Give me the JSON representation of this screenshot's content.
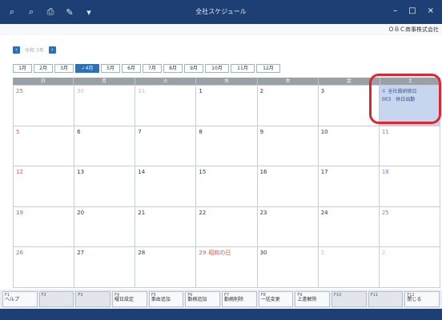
{
  "window": {
    "title": "全社スケジュール",
    "minimize": "–",
    "maximize": "□",
    "close": "×"
  },
  "toolbar": [
    {
      "icon": "search-plus-icon",
      "glyph": "⌕"
    },
    {
      "icon": "search-icon",
      "glyph": "⌕"
    },
    {
      "icon": "printer-icon",
      "glyph": "⎙"
    },
    {
      "icon": "pen-icon",
      "glyph": "✎"
    },
    {
      "icon": "dropdown-icon",
      "glyph": "▾"
    }
  ],
  "company": "ＯＢＣ商事株式会社",
  "year_selector": {
    "prev": "‹",
    "label": "令和 3年",
    "next": "›"
  },
  "months": [
    {
      "label": "1月"
    },
    {
      "label": "2月"
    },
    {
      "label": "3月"
    },
    {
      "label": "✓4月",
      "active": true
    },
    {
      "label": "5月"
    },
    {
      "label": "6月"
    },
    {
      "label": "7月"
    },
    {
      "label": "8月"
    },
    {
      "label": "9月"
    },
    {
      "label": "10月"
    },
    {
      "label": "11月"
    },
    {
      "label": "12月"
    }
  ],
  "weekdays": [
    "日",
    "月",
    "火",
    "水",
    "木",
    "金",
    "土"
  ],
  "weeks": [
    [
      {
        "day": "25",
        "style": "other-sun"
      },
      {
        "day": "30",
        "style": "other"
      },
      {
        "day": "31",
        "style": "other"
      },
      {
        "day": "1"
      },
      {
        "day": "2"
      },
      {
        "day": "3"
      },
      {
        "day": "4",
        "style": "sat",
        "highlight": true,
        "events": [
          "全社員研修日",
          "003　休日出勤"
        ]
      }
    ],
    [
      {
        "day": "5",
        "style": "sun"
      },
      {
        "day": "6"
      },
      {
        "day": "7"
      },
      {
        "day": "8"
      },
      {
        "day": "9"
      },
      {
        "day": "10"
      },
      {
        "day": "11",
        "style": "sat"
      }
    ],
    [
      {
        "day": "12",
        "style": "sun"
      },
      {
        "day": "13"
      },
      {
        "day": "14"
      },
      {
        "day": "15"
      },
      {
        "day": "16"
      },
      {
        "day": "17"
      },
      {
        "day": "18",
        "style": "sat"
      }
    ],
    [
      {
        "day": "19",
        "style": "sun"
      },
      {
        "day": "20"
      },
      {
        "day": "21"
      },
      {
        "day": "22"
      },
      {
        "day": "23"
      },
      {
        "day": "24"
      },
      {
        "day": "25",
        "style": "sat"
      }
    ],
    [
      {
        "day": "26",
        "style": "sun"
      },
      {
        "day": "27"
      },
      {
        "day": "28"
      },
      {
        "day": "29",
        "style": "holiday",
        "holiday_name": "昭和の日"
      },
      {
        "day": "30"
      },
      {
        "day": "1",
        "style": "other"
      },
      {
        "day": "2",
        "style": "other"
      }
    ]
  ],
  "function_keys": [
    {
      "key": "F1",
      "label": "ヘルプ"
    },
    {
      "key": "F2",
      "label": "",
      "disabled": true
    },
    {
      "key": "F3",
      "label": "",
      "disabled": true
    },
    {
      "key": "F4",
      "label": "曜日設定"
    },
    {
      "key": "F5",
      "label": "事由追加"
    },
    {
      "key": "F6",
      "label": "勤務追加"
    },
    {
      "key": "F7",
      "label": "勤務削除"
    },
    {
      "key": "F8",
      "label": "一括変更"
    },
    {
      "key": "F9",
      "label": "上書解除"
    },
    {
      "key": "F10",
      "label": "",
      "disabled": true
    },
    {
      "key": "F11",
      "label": "",
      "disabled": true
    },
    {
      "key": "F12",
      "label": "閉じる"
    }
  ],
  "colors": {
    "titlebar": "#1e3f73",
    "accent": "#2f6fb5",
    "highlight_cell": "#c7d5ee",
    "sunday": "#e0554a",
    "saturday": "#6d8ad0",
    "ring": "#e0262c"
  }
}
